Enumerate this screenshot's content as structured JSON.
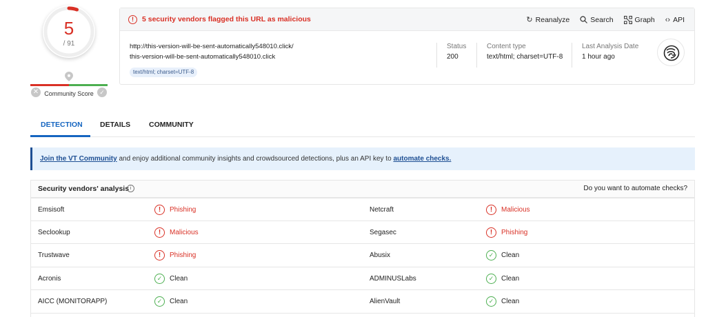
{
  "score": {
    "detections": "5",
    "total": "/ 91",
    "fraction": 0.055,
    "community_label": "Community Score",
    "colors": {
      "malicious": "#d93025",
      "clean": "#4caf50",
      "link": "#1e4f93",
      "accent": "#1565c0"
    }
  },
  "header": {
    "alert": "5 security vendors flagged this URL as malicious",
    "actions": [
      {
        "label": "Reanalyze",
        "icon": "refresh-icon"
      },
      {
        "label": "Search",
        "icon": "search-icon"
      },
      {
        "label": "Graph",
        "icon": "graph-icon"
      },
      {
        "label": "API",
        "icon": "api-icon"
      }
    ],
    "url_line1": "http://this-version-will-be-sent-automatically548010.click/",
    "url_line2": "this-version-will-be-sent-automatically548010.click",
    "mime_chip": "text/html; charset=UTF-8",
    "status_label": "Status",
    "status_value": "200",
    "content_type_label": "Content type",
    "content_type_value": "text/html; charset=UTF-8",
    "last_analysis_label": "Last Analysis Date",
    "last_analysis_value": "1 hour ago",
    "site_icon": "globe-fingerprint-icon"
  },
  "tabs": [
    "DETECTION",
    "DETAILS",
    "COMMUNITY"
  ],
  "banner": {
    "link1": "Join the VT Community",
    "text": " and enjoy additional community insights and crowdsourced detections, plus an API key to ",
    "link2": "automate checks."
  },
  "vendors": {
    "title": "Security vendors' analysis",
    "automate_prompt": "Do you want to automate checks?",
    "rows": [
      {
        "left_name": "Emsisoft",
        "left_result": "Phishing",
        "left_status": "bad",
        "right_name": "Netcraft",
        "right_result": "Malicious",
        "right_status": "bad"
      },
      {
        "left_name": "Seclookup",
        "left_result": "Malicious",
        "left_status": "bad",
        "right_name": "Segasec",
        "right_result": "Phishing",
        "right_status": "bad"
      },
      {
        "left_name": "Trustwave",
        "left_result": "Phishing",
        "left_status": "bad",
        "right_name": "Abusix",
        "right_result": "Clean",
        "right_status": "good"
      },
      {
        "left_name": "Acronis",
        "left_result": "Clean",
        "left_status": "good",
        "right_name": "ADMINUSLabs",
        "right_result": "Clean",
        "right_status": "good"
      },
      {
        "left_name": "AICC (MONITORAPP)",
        "left_result": "Clean",
        "left_status": "good",
        "right_name": "AlienVault",
        "right_result": "Clean",
        "right_status": "good"
      }
    ]
  }
}
